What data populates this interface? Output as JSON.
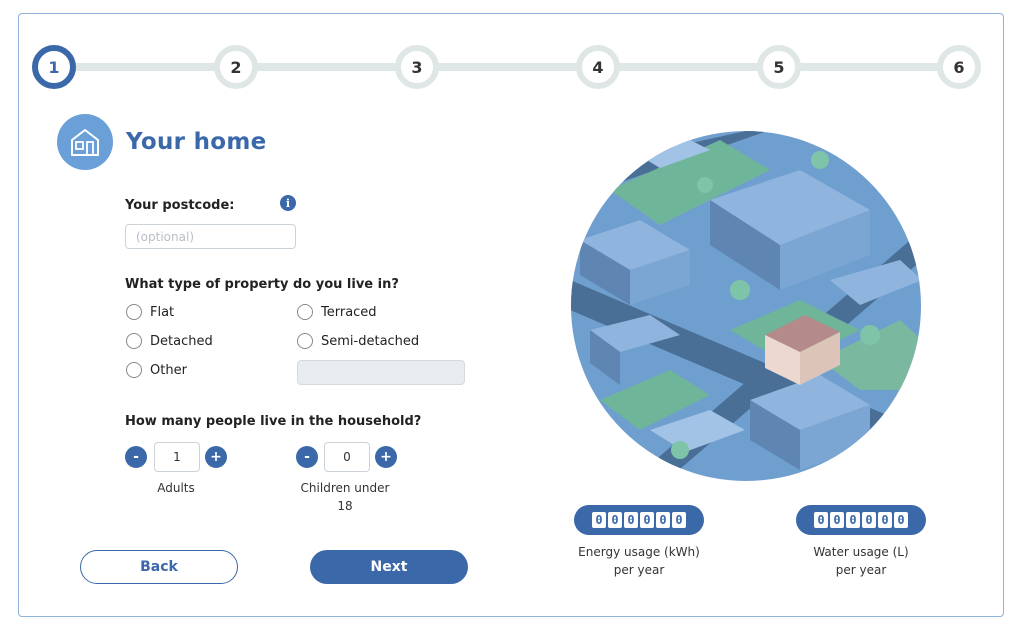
{
  "stepper": {
    "steps": [
      "1",
      "2",
      "3",
      "4",
      "5",
      "6"
    ],
    "active": 1
  },
  "section": {
    "title": "Your home",
    "icon": "house-icon"
  },
  "postcode": {
    "label": "Your postcode:",
    "placeholder": "(optional)",
    "value": "",
    "info_icon": "info-icon"
  },
  "property": {
    "question": "What type of property do you live in?",
    "options": [
      "Flat",
      "Terraced",
      "Detached",
      "Semi-detached",
      "Other"
    ],
    "selected": null
  },
  "household": {
    "question": "How many people live in the household?",
    "adults": {
      "value": "1",
      "label": "Adults",
      "minus": "-",
      "plus": "+"
    },
    "children": {
      "value": "0",
      "label_line1": "Children under",
      "label_line2": "18",
      "minus": "-",
      "plus": "+"
    }
  },
  "buttons": {
    "back": "Back",
    "next": "Next"
  },
  "meters": {
    "energy": {
      "digits": [
        "0",
        "0",
        "0",
        "0",
        "0",
        "0"
      ],
      "label_line1": "Energy usage (kWh)",
      "label_line2": "per year"
    },
    "water": {
      "digits": [
        "0",
        "0",
        "0",
        "0",
        "0",
        "0"
      ],
      "label_line1": "Water usage (L)",
      "label_line2": "per year"
    }
  },
  "colors": {
    "primary": "#3a68a8",
    "step_track": "#dfe6e6",
    "frame_border": "#8fb3da",
    "icon_bg": "#6b9fd8"
  }
}
